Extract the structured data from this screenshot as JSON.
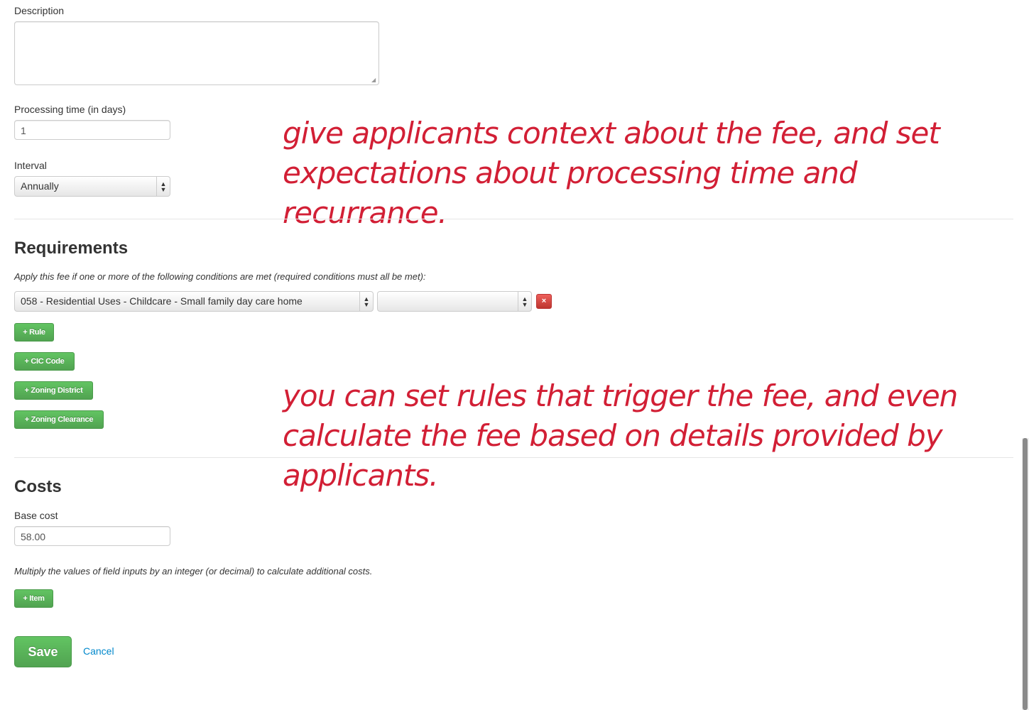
{
  "fields": {
    "description_label": "Description",
    "description_value": "",
    "processing_label": "Processing time (in days)",
    "processing_value": "1",
    "interval_label": "Interval",
    "interval_value": "Annually"
  },
  "requirements": {
    "heading": "Requirements",
    "instruction": "Apply this fee if one or more of the following conditions are met (required conditions must all be met):",
    "condition_select_value": "058 - Residential Uses - Childcare - Small family day care home",
    "condition_value_select": "",
    "remove_label": "×",
    "buttons": {
      "rule": "+ Rule",
      "cic_code": "+ CIC Code",
      "zoning_district": "+ Zoning District",
      "zoning_clearance": "+ Zoning Clearance"
    }
  },
  "costs": {
    "heading": "Costs",
    "base_cost_label": "Base cost",
    "base_cost_value": "58.00",
    "multiplier_note": "Multiply the values of field inputs by an integer (or decimal) to calculate additional costs.",
    "add_item": "+ Item"
  },
  "actions": {
    "save": "Save",
    "cancel": "Cancel"
  },
  "annotations": {
    "note1_line1": "give applicants context about the fee, and set",
    "note1_line2": "expectations about processing time and recurrance.",
    "note2_line1": "you can set rules that trigger the fee, and even",
    "note2_line2": "calculate the fee based on details provided by",
    "note2_line3": "applicants.",
    "color": "#d21f35"
  },
  "icons": {
    "select_arrows": "updown-arrows-icon",
    "remove": "close-icon"
  },
  "colors": {
    "primary_green": "#51a351",
    "danger_red": "#bd362f",
    "link_blue": "#0088cc"
  }
}
